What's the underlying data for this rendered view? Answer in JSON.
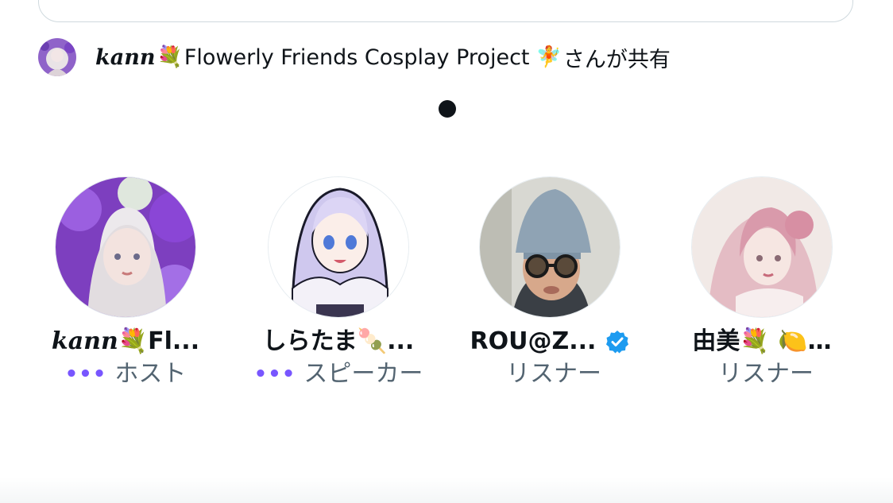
{
  "shared": {
    "name": "kann",
    "emoji_left": "💐",
    "project": "Flowerly Friends Cosplay Project",
    "emoji_right": "🧚",
    "suffix": "さんが共有"
  },
  "participants": [
    {
      "name_serif": "kann",
      "name_rest": "💐Fl...",
      "role_dots": "•••",
      "role": "ホスト",
      "verified": false,
      "avatar_icon": "lavender-cosplayer-avatar"
    },
    {
      "name_serif": "",
      "name_rest": "しらたま🍡...",
      "role_dots": "•••",
      "role": "スピーカー",
      "verified": false,
      "avatar_icon": "anime-girl-avatar"
    },
    {
      "name_serif": "",
      "name_rest": "ROU@Z...",
      "role_dots": "",
      "role": "リスナー",
      "verified": true,
      "avatar_icon": "man-with-hat-avatar"
    },
    {
      "name_serif": "",
      "name_rest": "由美💐 🍋…",
      "role_dots": "",
      "role": "リスナー",
      "verified": false,
      "avatar_icon": "pink-hair-cosplayer-avatar"
    }
  ],
  "colors": {
    "accent_dots": "#7856ff",
    "verified_blue": "#1d9bf0",
    "secondary_text": "#536471"
  }
}
